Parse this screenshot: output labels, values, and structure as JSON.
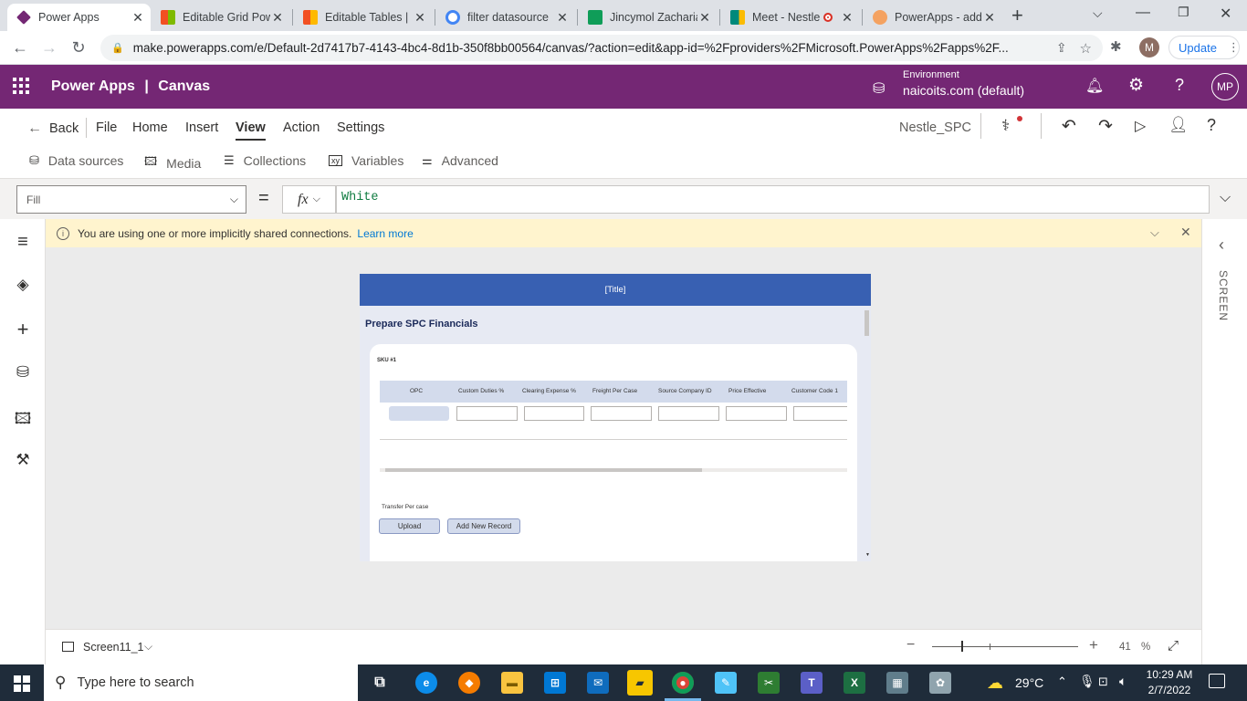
{
  "browser": {
    "tabs": [
      {
        "title": "Power Apps",
        "favicon_color": "#742774",
        "active": true
      },
      {
        "title": "Editable Grid Pow",
        "favicon_color": "#f25022",
        "active": false
      },
      {
        "title": "Editable Tables |",
        "favicon_color": "#f25022",
        "active": false
      },
      {
        "title": "filter datasource",
        "favicon_color": "#4285f4",
        "active": false
      },
      {
        "title": "Jincymol Zacharia",
        "favicon_color": "#0f9d58",
        "active": false
      },
      {
        "title": "Meet - Nestle",
        "favicon_color": "#00897b",
        "active": false
      },
      {
        "title": "PowerApps - add",
        "favicon_color": "#f4a261",
        "active": false
      }
    ],
    "new_tab": "+",
    "url": "make.powerapps.com/e/Default-2d7417b7-4143-4bc4-8d1b-350f8bb00564/canvas/?action=edit&app-id=%2Fproviders%2FMicrosoft.PowerApps%2Fapps%2F...",
    "profile_initial": "M",
    "update_label": "Update"
  },
  "header": {
    "app_name": "Power Apps",
    "separator": "|",
    "mode": "Canvas",
    "environment_label": "Environment",
    "environment_value": "naicoits.com (default)",
    "user_initials": "MP"
  },
  "menu": {
    "back": "Back",
    "items": [
      "File",
      "Home",
      "Insert",
      "View",
      "Action",
      "Settings"
    ],
    "active": "View",
    "app_title": "Nestle_SPC"
  },
  "toolbar": {
    "items": [
      "Data sources",
      "Media",
      "Collections",
      "Variables",
      "Advanced"
    ]
  },
  "formula": {
    "property": "Fill",
    "equals": "=",
    "fx": "fx",
    "value": "White"
  },
  "notice": {
    "text": "You are using one or more implicitly shared connections.",
    "link": "Learn more"
  },
  "right_panel": {
    "label": "SCREEN"
  },
  "app": {
    "title": "[Title]",
    "heading": "Prepare SPC Financials",
    "sku_label": "SKU #1",
    "columns": [
      "OPC",
      "Custom Duties %",
      "Clearing Expense %",
      "Freight Per Case",
      "Source Company ID",
      "Price Effective",
      "Customer Code 1"
    ],
    "transfer_label": "Transfer Per case",
    "upload_button": "Upload",
    "add_record_button": "Add New Record"
  },
  "status": {
    "screen_name": "Screen11_1",
    "zoom_value": "41",
    "zoom_unit": "%"
  },
  "taskbar": {
    "search_placeholder": "Type here to search",
    "temperature": "29°C",
    "time": "10:29 AM",
    "date": "2/7/2022"
  }
}
